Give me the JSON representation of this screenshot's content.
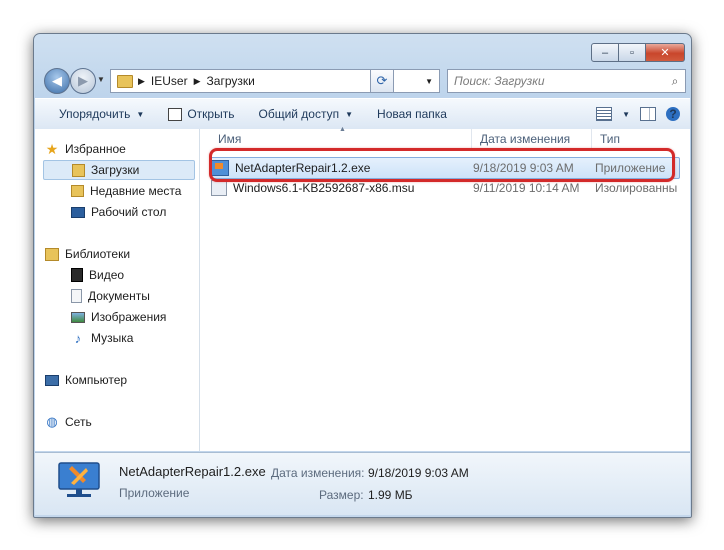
{
  "window": {
    "caption": {
      "minimize": "–",
      "maximize": "▫",
      "close": "✕"
    }
  },
  "nav": {
    "address": {
      "root": "IEUser",
      "current": "Загрузки"
    },
    "search_placeholder": "Поиск: Загрузки"
  },
  "toolbar": {
    "organize": "Упорядочить",
    "open": "Открыть",
    "share": "Общий доступ",
    "new_folder": "Новая папка"
  },
  "sidebar": {
    "favorites": {
      "header": "Избранное",
      "items": [
        "Загрузки",
        "Недавние места",
        "Рабочий стол"
      ]
    },
    "libraries": {
      "header": "Библиотеки",
      "items": [
        "Видео",
        "Документы",
        "Изображения",
        "Музыка"
      ]
    },
    "computer": "Компьютер",
    "network": "Сеть"
  },
  "columns": {
    "name": "Имя",
    "date": "Дата изменения",
    "type": "Тип"
  },
  "files": [
    {
      "name": "NetAdapterRepair1.2.exe",
      "date": "9/18/2019 9:03 AM",
      "type": "Приложение",
      "selected": true
    },
    {
      "name": "Windows6.1-KB2592687-x86.msu",
      "date": "9/11/2019 10:14 AM",
      "type": "Изолированны",
      "selected": false
    }
  ],
  "details": {
    "name": "NetAdapterRepair1.2.exe",
    "type": "Приложение",
    "date_label": "Дата изменения:",
    "date_value": "9/18/2019 9:03 AM",
    "size_label": "Размер:",
    "size_value": "1.99 МБ"
  },
  "colors": {
    "highlight": "#d32a2a",
    "selection": "#cde3f9",
    "accent": "#2d6fc1"
  }
}
